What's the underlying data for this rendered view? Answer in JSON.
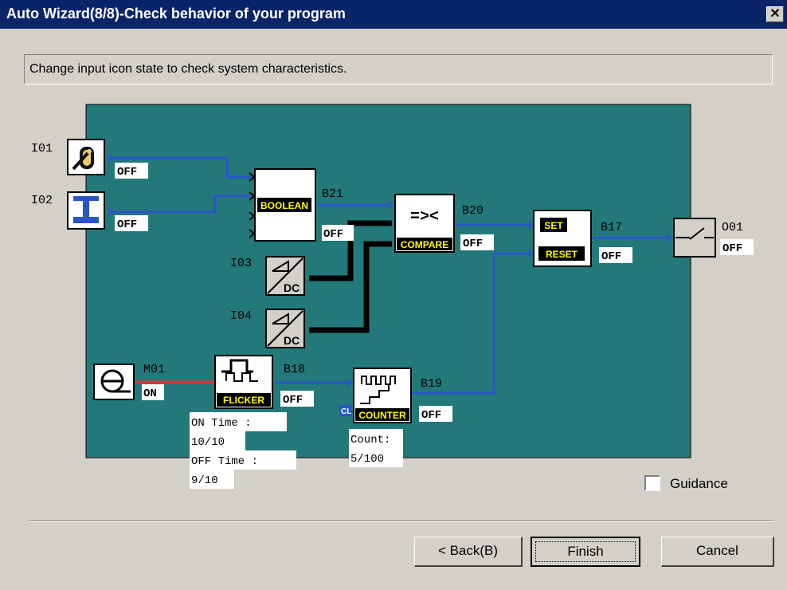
{
  "window": {
    "title": "Auto Wizard(8/8)-Check behavior of your program",
    "close_glyph": "✕"
  },
  "instruction": "Change input icon state to check system characteristics.",
  "diagram": {
    "background_color": "#23797a",
    "inputs": [
      {
        "id": "I01",
        "state": "OFF",
        "icon": "toggle-switch-icon"
      },
      {
        "id": "I02",
        "state": "OFF",
        "icon": "push-button-icon"
      },
      {
        "id": "I03",
        "icon": "analog-dc-input-icon",
        "sub_label": "DC"
      },
      {
        "id": "I04",
        "icon": "analog-dc-input-icon",
        "sub_label": "DC"
      },
      {
        "id": "M01",
        "state": "ON",
        "icon": "constant-marker-icon"
      }
    ],
    "blocks": {
      "boolean": {
        "id": "B21",
        "label": "BOOLEAN",
        "state": "OFF"
      },
      "compare": {
        "id": "B20",
        "symbol": "=><",
        "label": "COMPARE",
        "state": "OFF"
      },
      "setreset": {
        "id": "B17",
        "set_label": "SET",
        "reset_label": "RESET",
        "state": "OFF"
      },
      "flicker": {
        "id": "B18",
        "label": "FLICKER",
        "state": "OFF",
        "info": [
          "ON Time :",
          "10/10",
          "OFF Time :",
          "9/10"
        ]
      },
      "counter": {
        "id": "B19",
        "label": "COUNTER",
        "state": "OFF",
        "cl_label": "CL",
        "info": [
          "Count:",
          "5/100"
        ]
      }
    },
    "output": {
      "id": "O01",
      "state": "OFF",
      "icon": "relay-output-icon"
    },
    "colors": {
      "wire": "#2a55c8",
      "analog_wire": "#000000",
      "active_wire": "#e83030",
      "label_yellow": "#ffff00"
    }
  },
  "guidance": {
    "label": "Guidance",
    "checked": false
  },
  "buttons": {
    "back": "< Back(B)",
    "finish": "Finish",
    "cancel": "Cancel"
  }
}
